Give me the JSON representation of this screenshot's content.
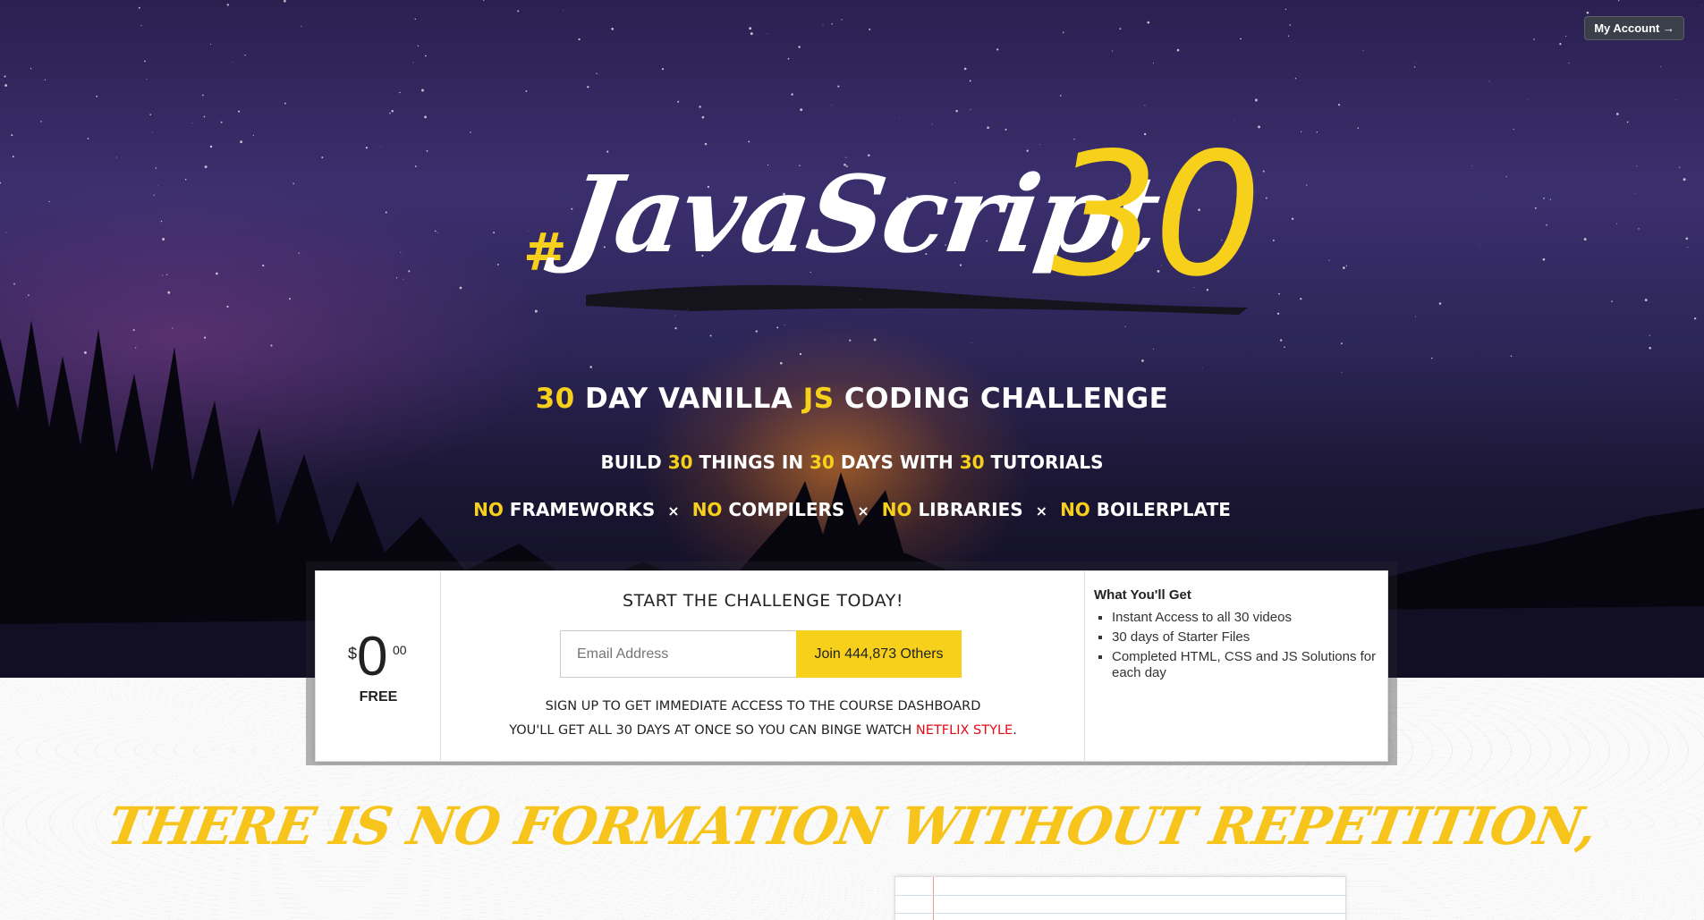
{
  "header": {
    "account_label": "My Account →"
  },
  "logo": {
    "hash": "#",
    "word": "JavaScript",
    "number": "30"
  },
  "hero": {
    "line1": {
      "n1": "30",
      "t1": "Day Vanilla",
      "js": "JS",
      "t2": "Coding Challenge"
    },
    "line2": {
      "t1": "Build",
      "n1": "30",
      "t2": "things in",
      "n2": "30",
      "t3": "days with",
      "n3": "30",
      "t4": "tutorials"
    },
    "line3": [
      {
        "no": "No",
        "label": "Frameworks"
      },
      {
        "no": "No",
        "label": "Compilers"
      },
      {
        "no": "No",
        "label": "Libraries"
      },
      {
        "no": "No",
        "label": "Boilerplate"
      }
    ],
    "separator": "×"
  },
  "signup": {
    "price": {
      "currency": "$",
      "amount": "0",
      "cents": "00",
      "label": "FREE"
    },
    "heading": "Start the Challenge Today!",
    "email_placeholder": "Email Address",
    "join_label": "Join 444,873 Others",
    "note1": "Sign up to get immediate access to the course dashboard",
    "note2_prefix": "You'll get all 30 days at once so you can binge watch ",
    "note2_link": "Netflix style",
    "note2_suffix": "."
  },
  "benefits": {
    "title": "What You'll Get",
    "items": [
      "Instant Access to all 30 videos",
      "30 days of Starter Files",
      "Completed HTML, CSS and JS Solutions for each day"
    ]
  },
  "quote": "There is no formation without repetition,",
  "colors": {
    "accent": "#f7d01b",
    "netflix": "#e50914",
    "hero_bg": "#2c2556"
  }
}
